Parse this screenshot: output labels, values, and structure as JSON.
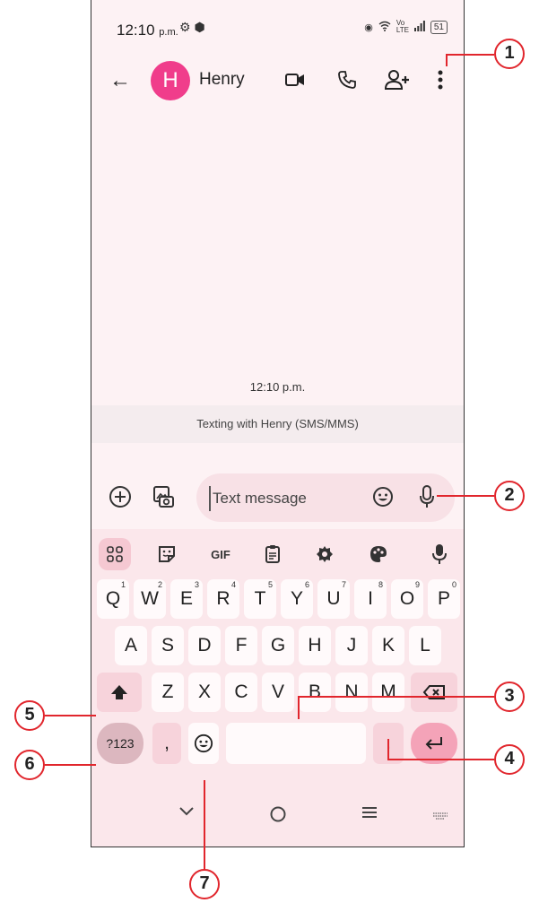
{
  "status_bar": {
    "time": "12:10",
    "time_suffix": "p.m.",
    "network_label": "Vo LTE",
    "battery": "51"
  },
  "header": {
    "avatar_letter": "H",
    "contact_name": "Henry"
  },
  "conversation": {
    "timestamp": "12:10 p.m.",
    "banner": "Texting with Henry (SMS/MMS)"
  },
  "compose": {
    "placeholder": "Text message"
  },
  "keyboard": {
    "toolbar": [
      "apps-grid-icon",
      "sticker-icon",
      "GIF",
      "clipboard-icon",
      "settings-icon",
      "palette-icon",
      "mic-icon"
    ],
    "row1": [
      {
        "k": "Q",
        "n": "1"
      },
      {
        "k": "W",
        "n": "2"
      },
      {
        "k": "E",
        "n": "3"
      },
      {
        "k": "R",
        "n": "4"
      },
      {
        "k": "T",
        "n": "5"
      },
      {
        "k": "Y",
        "n": "6"
      },
      {
        "k": "U",
        "n": "7"
      },
      {
        "k": "I",
        "n": "8"
      },
      {
        "k": "O",
        "n": "9"
      },
      {
        "k": "P",
        "n": "0"
      }
    ],
    "row2": [
      "A",
      "S",
      "D",
      "F",
      "G",
      "H",
      "J",
      "K",
      "L"
    ],
    "row3": [
      "Z",
      "X",
      "C",
      "V",
      "B",
      "N",
      "M"
    ],
    "symbols_key": "?123",
    "comma_key": ",",
    "period_key": "."
  },
  "callouts": [
    "1",
    "2",
    "3",
    "4",
    "5",
    "6",
    "7"
  ],
  "colors": {
    "accent": "#f03d8b",
    "callout": "#e1262d",
    "keyboard_bg": "#fbe7eb"
  }
}
